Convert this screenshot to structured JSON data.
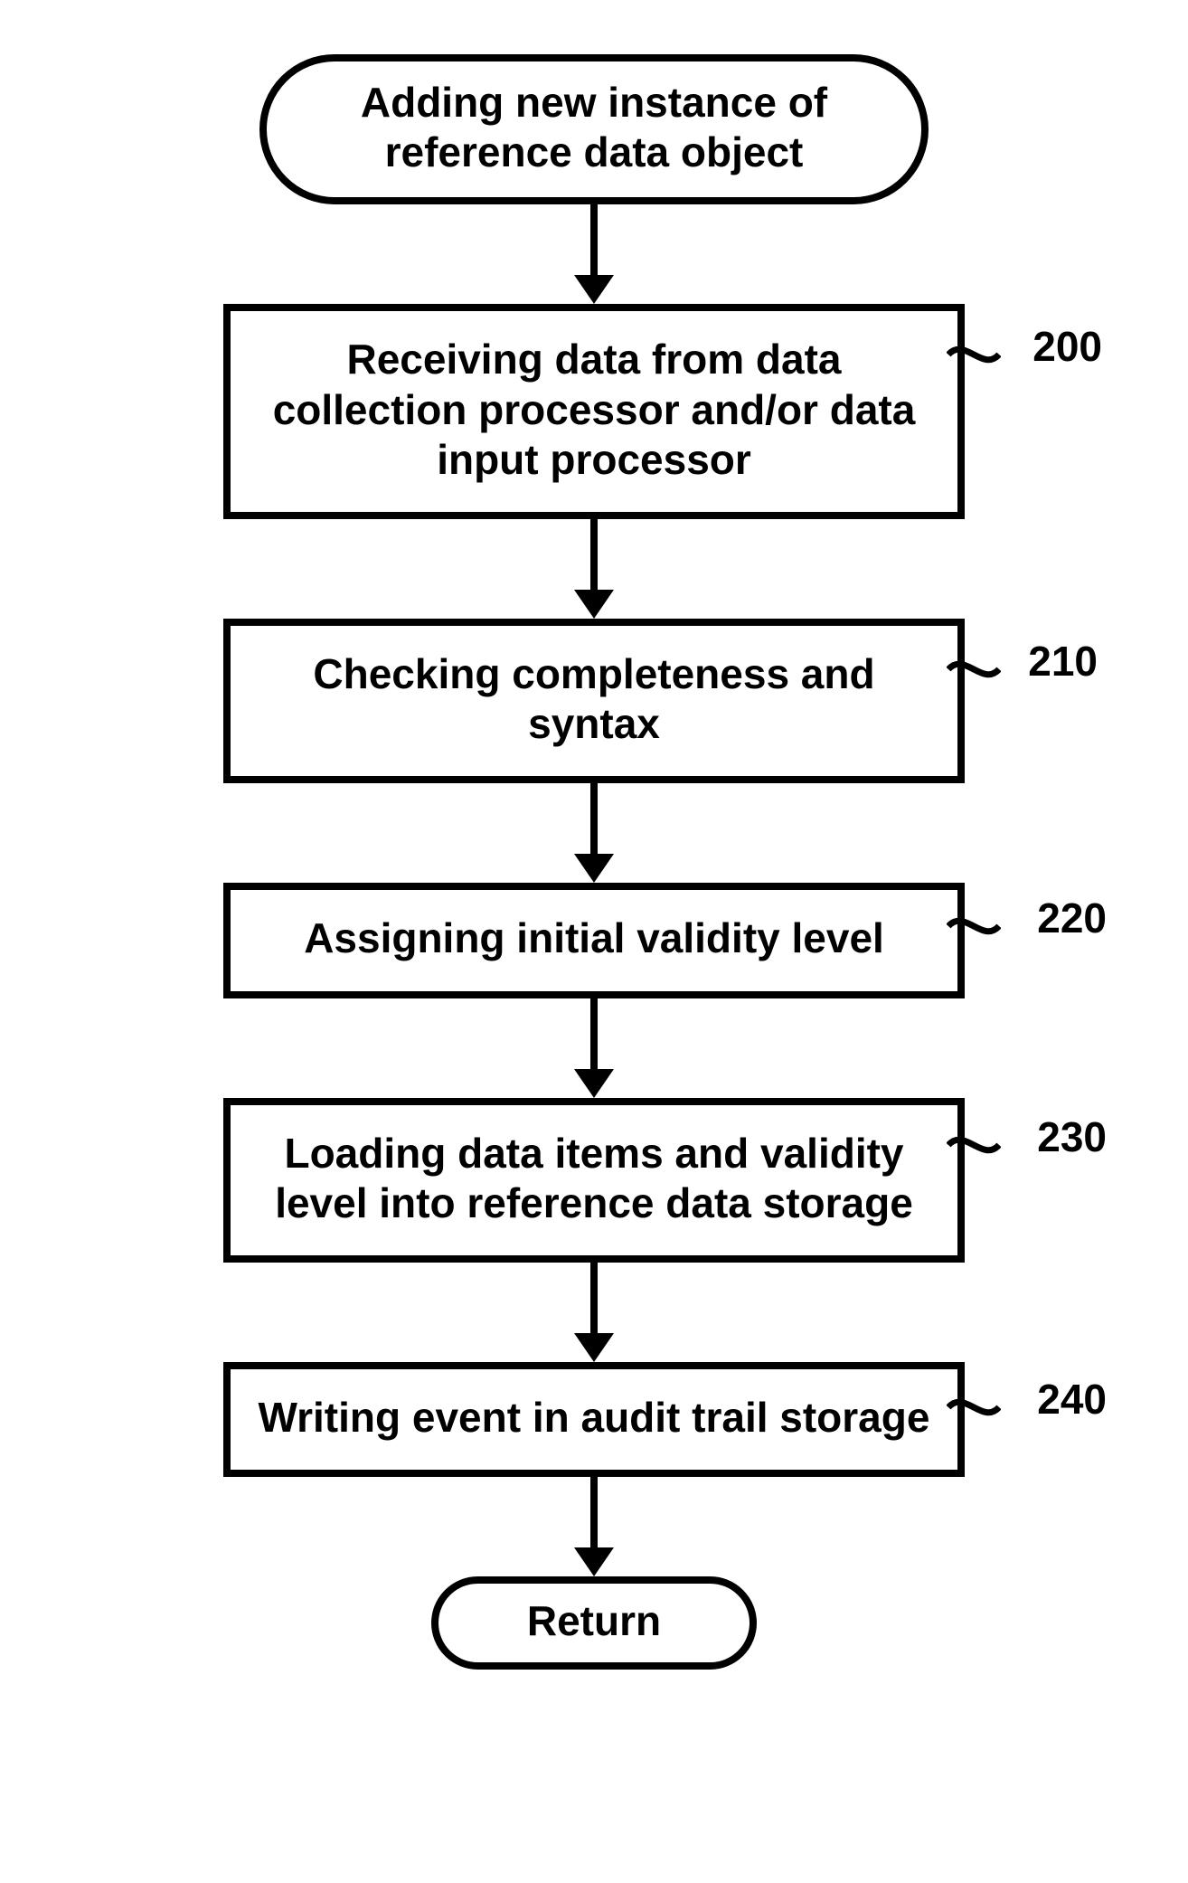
{
  "flow": {
    "start": "Adding new instance of reference data object",
    "steps": [
      {
        "text": "Receiving data from data collection processor and/or data input processor",
        "ref": "200"
      },
      {
        "text": "Checking completeness and syntax",
        "ref": "210"
      },
      {
        "text": "Assigning initial validity level",
        "ref": "220"
      },
      {
        "text": "Loading data items and validity level into reference data storage",
        "ref": "230"
      },
      {
        "text": "Writing event in audit trail storage",
        "ref": "240"
      }
    ],
    "end": "Return"
  }
}
